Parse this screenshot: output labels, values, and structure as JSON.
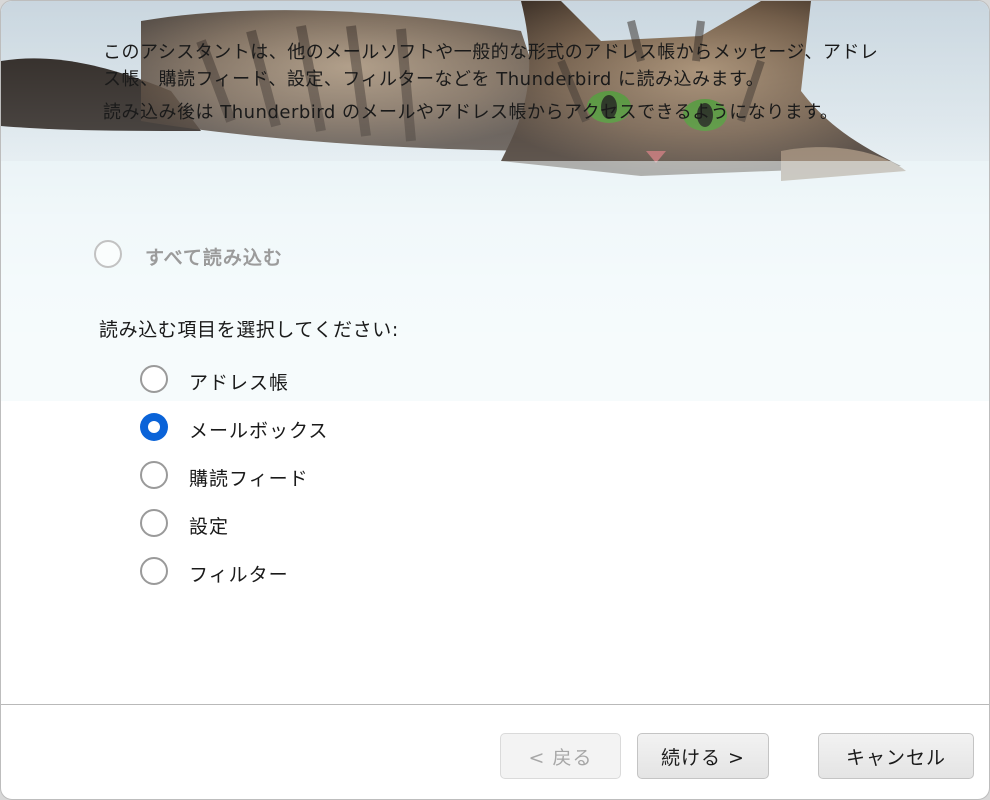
{
  "intro": {
    "paragraph1": "このアシスタントは、他のメールソフトや一般的な形式のアドレス帳からメッセージ、アドレス帳、購読フィード、設定、フィルターなどを Thunderbird に読み込みます。",
    "paragraph2": "読み込み後は Thunderbird のメールやアドレス帳からアクセスできるようになります。"
  },
  "import_all": {
    "label": "すべて読み込む",
    "checked": false,
    "enabled": false
  },
  "select_items_label": "読み込む項目を選択してください:",
  "items": [
    {
      "label": "アドレス帳",
      "checked": false
    },
    {
      "label": "メールボックス",
      "checked": true
    },
    {
      "label": "購読フィード",
      "checked": false
    },
    {
      "label": "設定",
      "checked": false
    },
    {
      "label": "フィルター",
      "checked": false
    }
  ],
  "buttons": {
    "back": "< 戻る",
    "continue": "続ける >",
    "cancel": "キャンセル"
  },
  "colors": {
    "accent": "#0a63d8"
  }
}
